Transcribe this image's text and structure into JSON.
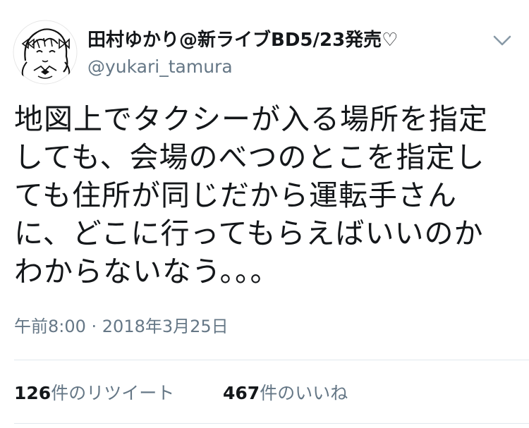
{
  "tweet": {
    "author": {
      "display_name": "田村ゆかり@新ライブBD5/23発売♡",
      "handle": "@yukari_tamura",
      "avatar_icon": "avatar-drawing-icon"
    },
    "menu_icon": "chevron-down-icon",
    "text": "地図上でタクシーが入る場所を指定\nしても、会場のべつのとこを指定し\nても住所が同じだから運転手さん\nに、どこに行ってもらえばいいのか\nわからないなう。。。",
    "timestamp": "午前8:00 · 2018年3月25日",
    "stats": {
      "retweets": {
        "count": "126",
        "label": "件のリツイート"
      },
      "likes": {
        "count": "467",
        "label": "件のいいね"
      }
    }
  },
  "colors": {
    "primary_text": "#14171a",
    "secondary_text": "#657786",
    "divider": "#e1e8ed",
    "background": "#ffffff"
  }
}
